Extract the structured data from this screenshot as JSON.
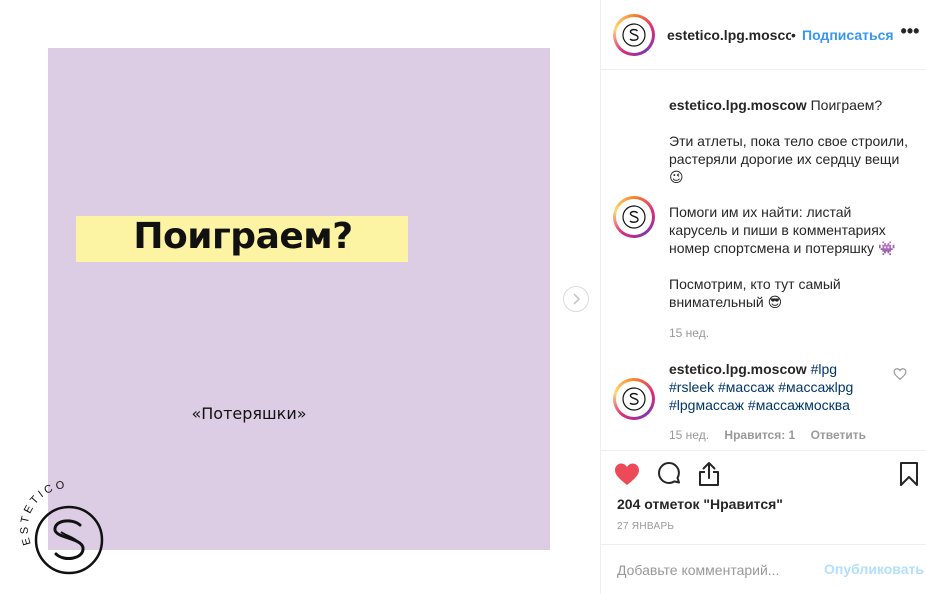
{
  "colors": {
    "slide_bg": "#dccde4",
    "highlight": "#fdf4a3",
    "link_blue": "#3897f0",
    "like_red": "#ed4956",
    "muted": "#999999",
    "publish_disabled": "#b2dffc"
  },
  "post": {
    "headline": "Поиграем?",
    "subtitle": "«Потеряшки»",
    "logo_text": "ESTETICO",
    "next_icon": "chevron-right-icon"
  },
  "header": {
    "username": "estetico.lpg.moscow",
    "separator": "•",
    "follow_label": "Подписаться",
    "more_label": "•••"
  },
  "caption": {
    "username": "estetico.lpg.moscow",
    "line1": " Поиграем?",
    "para2": "Эти атлеты, пока тело свое строили, растеряли дорогие их сердцу вещи 😉",
    "para3": "Помоги им их найти: листай карусель  и пиши в комментариях номер спортсмена и потеряшку 👾",
    "para4": "Посмотрим, кто тут самый внимательный 😎",
    "time": "15 нед."
  },
  "comment": {
    "username": "estetico.lpg.moscow",
    "tags": "#lpg #rsleek #массаж #массажlpg #lpgмассаж #массажмосква",
    "time": "15 нед.",
    "likes": "Нравится: 1",
    "reply": "Ответить"
  },
  "actions": {
    "like_icon": "heart-icon",
    "comment_icon": "comment-icon",
    "share_icon": "share-icon",
    "save_icon": "bookmark-icon"
  },
  "likes_text": "204 отметок \"Нравится\"",
  "date_text": "27 ЯНВАРЬ",
  "add_comment": {
    "placeholder": "Добавьте комментарий...",
    "publish_label": "Опубликовать"
  }
}
